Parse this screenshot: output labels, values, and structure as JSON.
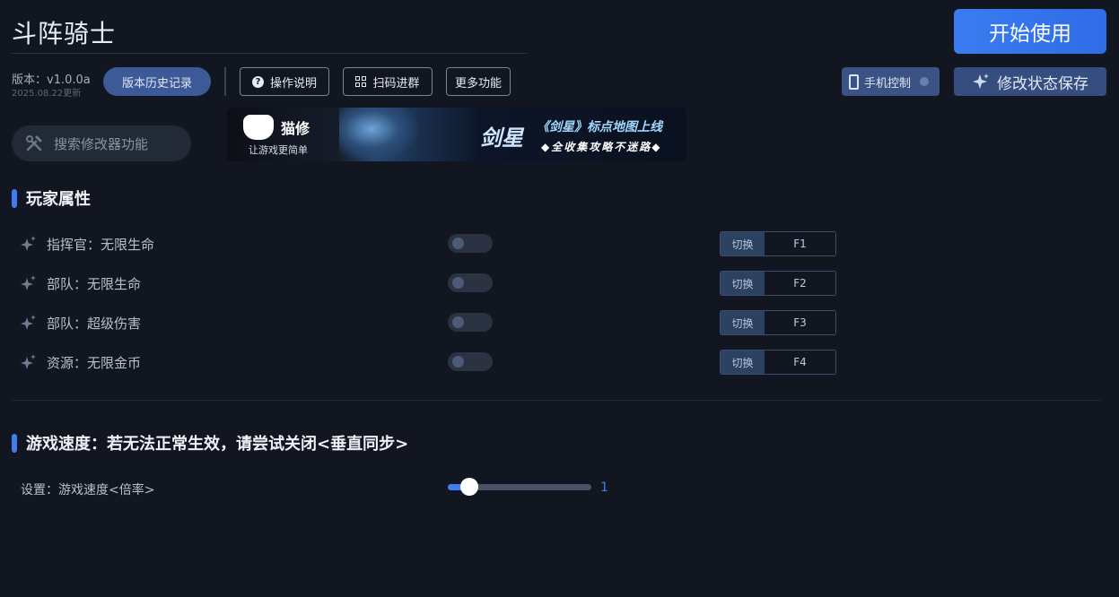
{
  "app": {
    "title": "斗阵骑士"
  },
  "header": {
    "start_label": "开始使用",
    "version": "版本：v1.0.0a",
    "version_date": "2025.08.22更新",
    "history_label": "版本历史记录",
    "help_label": "操作说明",
    "qr_label": "扫码进群",
    "more_label": "更多功能",
    "phone_label": "手机控制",
    "save_label": "修改状态保存"
  },
  "search": {
    "placeholder": "搜索修改器功能"
  },
  "banner": {
    "brand": "猫修",
    "slogan": "让游戏更简单",
    "game": "剑星",
    "line1": "《剑星》标点地图上线",
    "line2": "◆全收集攻略不迷路◆"
  },
  "sections": {
    "player": {
      "title": "玩家属性",
      "items": [
        {
          "label": "指挥官：无限生命",
          "hotkey_label": "切换",
          "key": "F1",
          "enabled": false
        },
        {
          "label": "部队：无限生命",
          "hotkey_label": "切换",
          "key": "F2",
          "enabled": false
        },
        {
          "label": "部队：超级伤害",
          "hotkey_label": "切换",
          "key": "F3",
          "enabled": false
        },
        {
          "label": "资源：无限金币",
          "hotkey_label": "切换",
          "key": "F4",
          "enabled": false
        }
      ]
    },
    "speed": {
      "title": "游戏速度：若无法正常生效，请尝试关闭<垂直同步>",
      "setting_label": "设置：游戏速度<倍率>",
      "value": "1",
      "slider_fraction": 0.15
    }
  },
  "colors": {
    "accent": "#3f7cf2",
    "background": "#111620"
  }
}
